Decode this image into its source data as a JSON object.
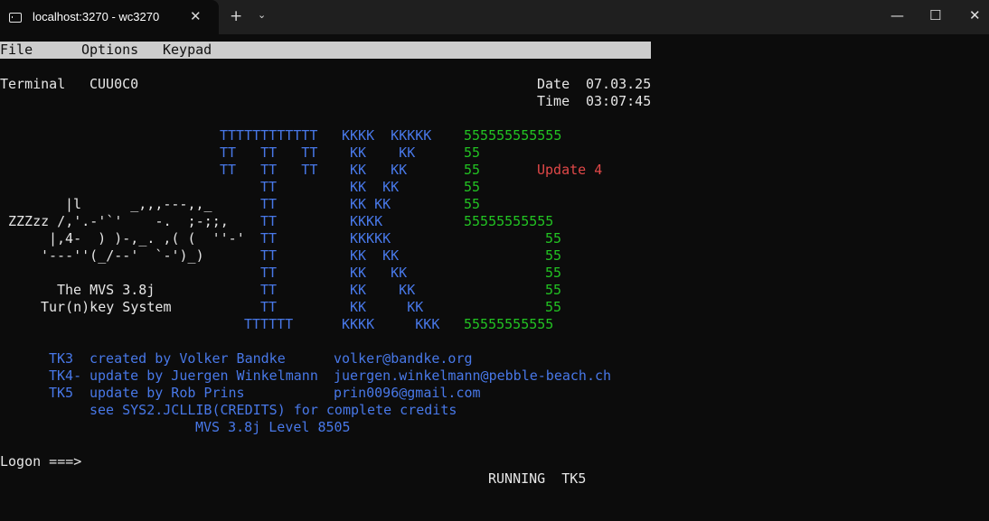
{
  "titlebar": {
    "tab_title": "localhost:3270 - wc3270",
    "close_tab": "✕",
    "new_tab": "+",
    "dropdown": "⌄",
    "minimize": "—",
    "maximize": "☐",
    "close_window": "✕"
  },
  "menu": {
    "file": "File",
    "options": "Options",
    "keypad": "Keypad"
  },
  "header": {
    "terminal_label": "Terminal",
    "terminal_id": "CUU0C0",
    "date_label": "Date",
    "date_value": "07.03.25",
    "time_label": "Time",
    "time_value": "03:07:45"
  },
  "banner": {
    "tt": [
      "TTTTTTTTTTTT",
      "TT   TT   TT",
      "TT   TT   TT",
      "TT",
      "TT",
      "TT",
      "TT",
      "TT",
      "TT",
      "TT",
      "TT",
      "TTTTTT"
    ],
    "kk": [
      "KKKK  KKKKK",
      "KK    KK",
      "KK   KK",
      "KK  KK",
      "KK KK",
      "KKKK",
      "KKKKK",
      "KK  KK",
      "KK   KK",
      "KK    KK",
      "KK     KK",
      "KKKK     KKK"
    ],
    "five": [
      "555555555555",
      "55",
      "55",
      "55",
      "55",
      "55555555555",
      "55",
      "55",
      "55",
      "55",
      "55",
      "55555555555"
    ],
    "update": "Update 4"
  },
  "art": [
    "|l      _,,,---,,_",
    "ZZZzz /,'.-'`'    -.  ;-;;,",
    "|,4-  ) )-,_. ,( (  ''-'",
    "'---''(_/--'  `-')_)"
  ],
  "system": {
    "line1": "The MVS 3.8j",
    "line2": "Tur(n)key System"
  },
  "credits": [
    {
      "tag": "TK3",
      "text": "created by Volker Bandke",
      "email": "volker@bandke.org"
    },
    {
      "tag": "TK4-",
      "text": "update by Juergen Winkelmann",
      "email": "juergen.winkelmann@pebble-beach.ch"
    },
    {
      "tag": "TK5",
      "text": "update by Rob Prins",
      "email": "prin0096@gmail.com"
    }
  ],
  "see_credits": "see SYS2.JCLLIB(CREDITS) for complete credits",
  "level": "MVS 3.8j Level 8505",
  "logon_prompt": "Logon ===>",
  "status": "RUNNING  TK5"
}
